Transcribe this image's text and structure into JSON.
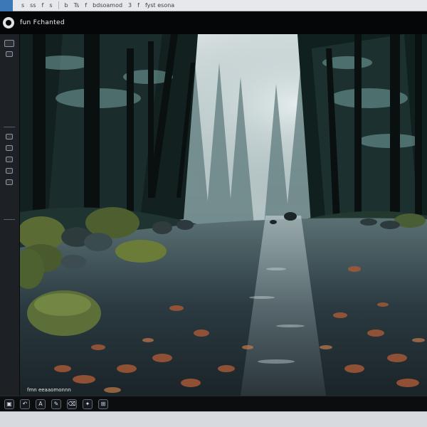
{
  "menubar": {
    "items": [
      "s",
      "ss",
      "f",
      "s",
      "b",
      "Ts",
      "f",
      "bdsoamod",
      "3",
      "f",
      "fyst esona"
    ]
  },
  "window": {
    "title": "fun Fchanted"
  },
  "canvas": {
    "caption": "fmn eeaaomonnn",
    "scene": "misty forest stream",
    "colors": {
      "sky": "#dfe4e5",
      "fog": "#8aa6a7",
      "trees_dark": "#0b1416",
      "water": "#2a3a40",
      "stones": "#5a6b34",
      "leaves": "#a35837"
    }
  },
  "toolbar_icons": [
    "layers-icon",
    "undo-icon",
    "text-icon",
    "brush-icon",
    "eraser-icon",
    "star-icon",
    "export-icon"
  ],
  "toolbar_glyphs": [
    "▣",
    "↶",
    "A",
    "✎",
    "⌫",
    "✦",
    "⊞"
  ]
}
